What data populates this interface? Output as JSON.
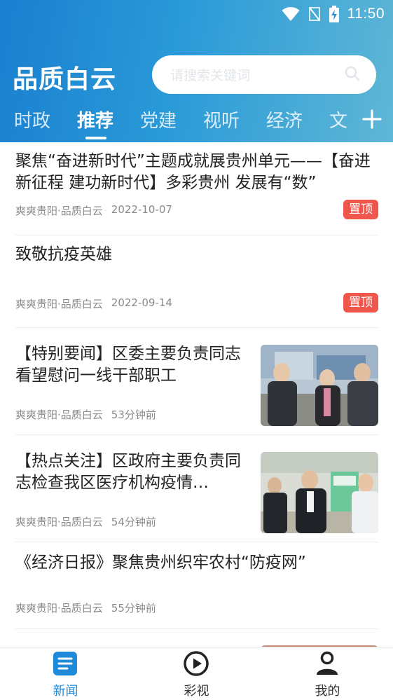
{
  "status": {
    "time": "11:50"
  },
  "header": {
    "logo": "品质白云",
    "search_placeholder": "请搜索关键词"
  },
  "tabs": [
    {
      "label": "时政",
      "active": false
    },
    {
      "label": "推荐",
      "active": true
    },
    {
      "label": "党建",
      "active": false
    },
    {
      "label": "视听",
      "active": false
    },
    {
      "label": "经济",
      "active": false
    },
    {
      "label": "文",
      "active": false
    }
  ],
  "articles": [
    {
      "title": "聚焦“奋进新时代”主题成就展贵州单元——【奋进新征程 建功新时代】多彩贵州 发展有“数”",
      "source": "爽爽贵阳·品质白云",
      "time": "2022-10-07",
      "badge": "置顶"
    },
    {
      "title": "致敬抗疫英雄",
      "source": "爽爽贵阳·品质白云",
      "time": "2022-09-14",
      "badge": "置顶"
    },
    {
      "title": "【特别要闻】区委主要负责同志看望慰问一线干部职工",
      "source": "爽爽贵阳·品质白云",
      "time": "53分钟前",
      "thumb": "photo-outdoor-visit"
    },
    {
      "title": "【热点关注】区政府主要负责同志检查我区医疗机构疫情…",
      "source": "爽爽贵阳·品质白云",
      "time": "54分钟前",
      "thumb": "photo-hospital-inspection"
    },
    {
      "title": "《经济日报》聚焦贵州织牢农村“防疫网”",
      "source": "爽爽贵阳·品质白云",
      "time": "55分钟前"
    }
  ],
  "bottom_nav": [
    {
      "label": "新闻",
      "icon": "news-icon",
      "active": true
    },
    {
      "label": "彩视",
      "icon": "play-circle-icon",
      "active": false
    },
    {
      "label": "我的",
      "icon": "user-icon",
      "active": false
    }
  ],
  "colors": {
    "accent": "#1e8ad9",
    "badge": "#f0564c",
    "header_start": "#1a7fd0",
    "header_end": "#5fb7d6"
  }
}
